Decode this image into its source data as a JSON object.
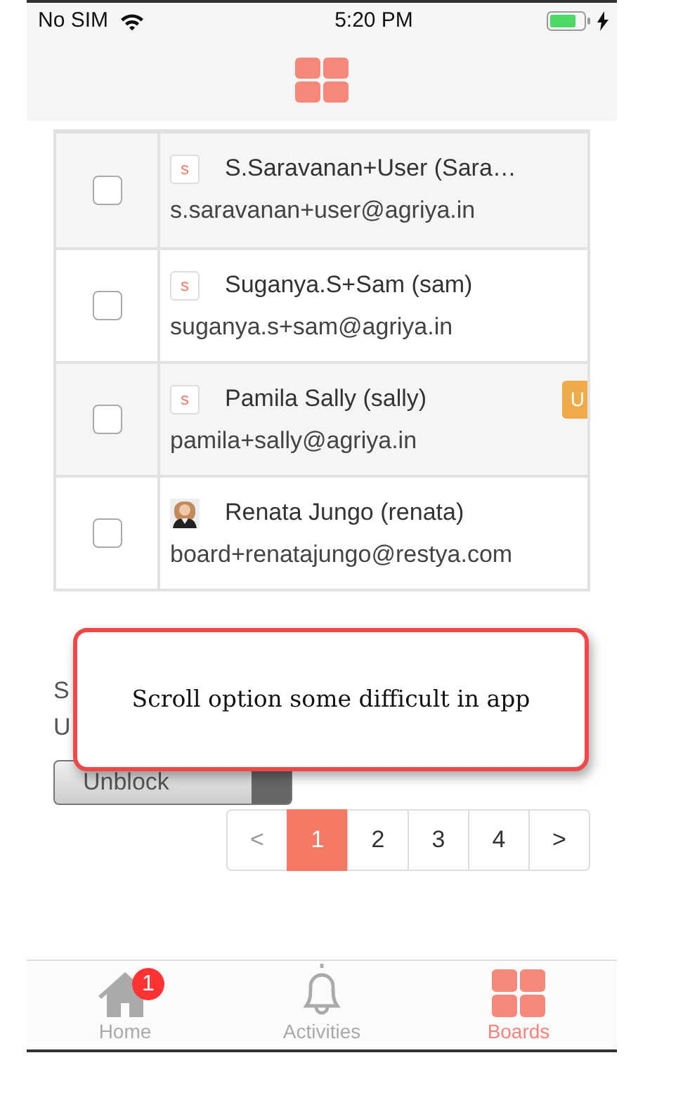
{
  "status_bar": {
    "carrier": "No SIM",
    "time": "5:20 PM",
    "charging": true
  },
  "users": [
    {
      "kind": "initial",
      "avatar": "s",
      "name": "S.Saravanan+User (Sara…",
      "email": "s.saravanan+user@agriya.in",
      "checked": false
    },
    {
      "kind": "initial",
      "avatar": "s",
      "name": "Suganya.S+Sam (sam)",
      "email": "suganya.s+sam@agriya.in",
      "checked": false
    },
    {
      "kind": "initial",
      "avatar": "s",
      "name": "Pamila Sally (sally)",
      "email": "pamila+sally@agriya.in",
      "checked": false,
      "tag": "U"
    },
    {
      "kind": "picture",
      "name": "Renata Jungo (renata)",
      "email": "board+renatajungo@restya.com",
      "checked": false
    }
  ],
  "bulk_action": {
    "labels": [
      "S",
      "U"
    ],
    "select_value": "Unblock"
  },
  "popup": {
    "text": "Scroll option some difficult in app"
  },
  "pagination": [
    {
      "label": "<",
      "selected": false
    },
    {
      "label": "1",
      "selected": true
    },
    {
      "label": "2",
      "selected": false
    },
    {
      "label": "3",
      "selected": false
    },
    {
      "label": "4",
      "selected": false
    },
    {
      "label": ">",
      "selected": false
    }
  ],
  "tab_bar": [
    {
      "kind": "home",
      "label": "Home",
      "badge": "1",
      "selected": false
    },
    {
      "kind": "bell",
      "label": "Activities",
      "selected": false
    },
    {
      "kind": "grid",
      "label": "Boards",
      "selected": true
    }
  ]
}
